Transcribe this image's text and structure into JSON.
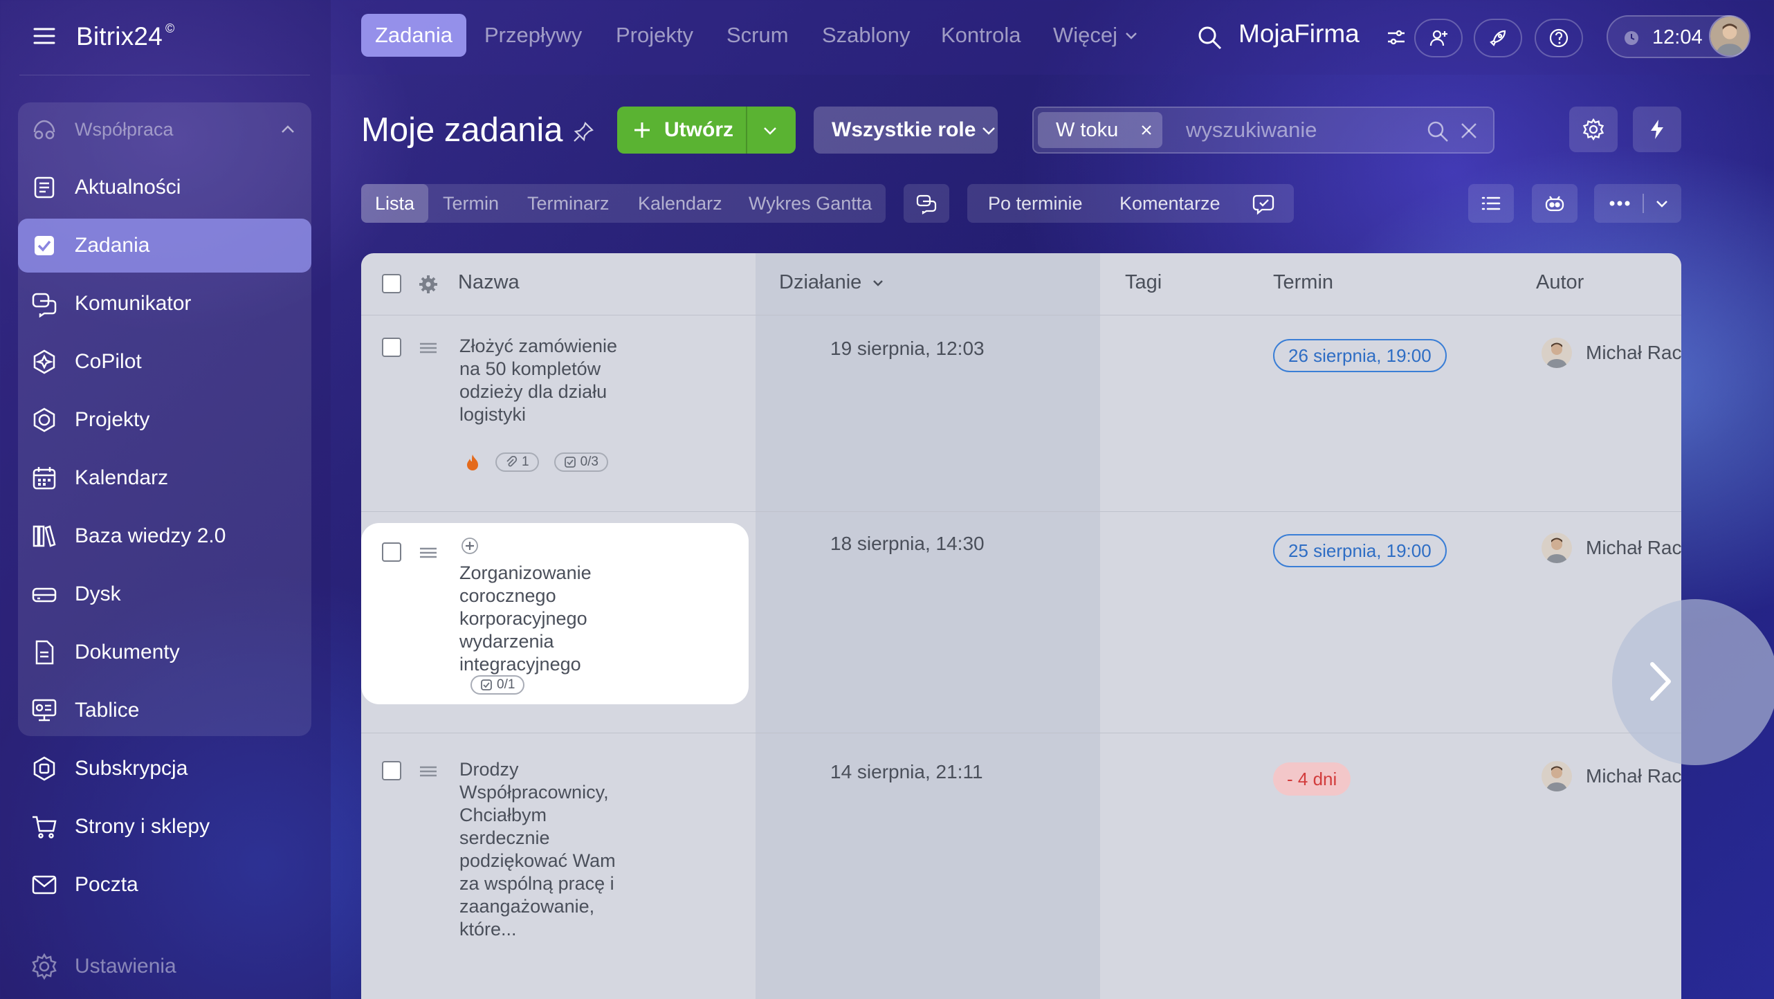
{
  "app": {
    "brand": "Bitrix24",
    "brand_mark": "©",
    "company": "MojaFirma",
    "time": "12:04"
  },
  "sidebar": {
    "section": "Współpraca",
    "items": [
      {
        "label": "Aktualności",
        "icon": "news-icon"
      },
      {
        "label": "Zadania",
        "icon": "tasks-checkbox-icon",
        "active": true
      },
      {
        "label": "Komunikator",
        "icon": "chat-icon"
      },
      {
        "label": "CoPilot",
        "icon": "copilot-icon"
      },
      {
        "label": "Projekty",
        "icon": "projects-icon"
      },
      {
        "label": "Kalendarz",
        "icon": "calendar-icon"
      },
      {
        "label": "Baza wiedzy 2.0",
        "icon": "knowledge-base-icon"
      },
      {
        "label": "Dysk",
        "icon": "drive-icon"
      },
      {
        "label": "Dokumenty",
        "icon": "documents-icon"
      },
      {
        "label": "Tablice",
        "icon": "boards-icon"
      }
    ],
    "bottom_items": [
      {
        "label": "Subskrypcja",
        "icon": "subscription-icon"
      },
      {
        "label": "Strony i sklepy",
        "icon": "cart-icon"
      },
      {
        "label": "Poczta",
        "icon": "mail-icon"
      }
    ],
    "settings": "Ustawienia"
  },
  "topnav": {
    "tabs": [
      "Zadania",
      "Przepływy",
      "Projekty",
      "Scrum",
      "Szablony",
      "Kontrola",
      "Więcej"
    ],
    "active": "Zadania"
  },
  "header": {
    "title": "Moje zadania",
    "create_label": "Utwórz",
    "roles_label": "Wszystkie role",
    "filter_chip": "W toku",
    "search_placeholder": "wyszukiwanie"
  },
  "views": {
    "tabs": [
      "Lista",
      "Termin",
      "Terminarz",
      "Kalendarz",
      "Wykres Gantta"
    ],
    "active": "Lista",
    "sort_label": "Po terminie",
    "comments_label": "Komentarze"
  },
  "table": {
    "columns": {
      "name": "Nazwa",
      "activity": "Działanie",
      "tags": "Tagi",
      "deadline": "Termin",
      "author": "Autor"
    },
    "rows": [
      {
        "title": "Złożyć zamówienie na 50 kompletów odzieży dla działu logistyki",
        "activity": "19 sierpnia, 12:03",
        "deadline": "26 sierpnia, 19:00",
        "deadline_state": "upcoming",
        "author": "Michał Rac",
        "badges": {
          "hot": true,
          "attachments": "1",
          "checklist": "0/3"
        }
      },
      {
        "title": "Zorganizowanie corocznego korporacyjnego wydarzenia integracyjnego",
        "activity": "18 sierpnia, 14:30",
        "deadline": "25 sierpnia, 19:00",
        "deadline_state": "upcoming",
        "author": "Michał Rac",
        "badges": {
          "checklist": "0/1"
        }
      },
      {
        "title": "Drodzy Współpracownicy, Chciałbym serdecznie podziękować Wam za wspólną pracę i zaangażowanie, które...",
        "activity": "14 sierpnia, 21:11",
        "deadline": "- 4 dni",
        "deadline_state": "overdue",
        "author": "Michał Rac"
      }
    ]
  },
  "colors": {
    "accent_green": "#5ab332",
    "active_tab": "#a09bf5",
    "deadline_blue": "#2e6dc4",
    "overdue_red": "#d23c3c"
  }
}
